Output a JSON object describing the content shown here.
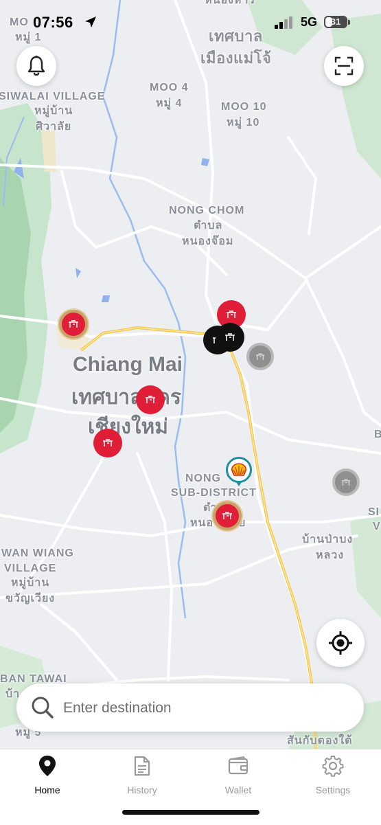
{
  "status_bar": {
    "time": "07:56",
    "network": "5G",
    "battery": "31"
  },
  "map": {
    "labels": {
      "mo": "MO",
      "mu1": "หมู่ 1",
      "mae_jo_1": "เทศบาล",
      "mae_jo_2": "เมืองแม่โจ้",
      "top_partial": "หนองหาร",
      "siwalai_en": "SIWALAI VILLAGE",
      "siwalai_th1": "หมู่บ้าน",
      "siwalai_th2": "ศิวาลัย",
      "moo4_en": "MOO 4",
      "moo4_th": "หมู่ 4",
      "moo10_en": "MOO 10",
      "moo10_th": "หมู่ 10",
      "nongchom_en": "NONG CHOM",
      "nongchom_th1": "ตำบล",
      "nongchom_th2": "หนองจ๊อม",
      "cm_en": "Chiang Mai",
      "cm_th1": "เทศบาลนคร",
      "cm_th2": "เชียงใหม่",
      "nongpa_en1": "NONG",
      "nongpa_en2": "SUB-DISTRICT",
      "nongpa_th1": "ตำ",
      "nongpa_th2": "หนอ",
      "nongpa_th2b": "ย",
      "wanwiang_en1": "WAN WIANG",
      "wanwiang_en2": "VILLAGE",
      "wanwiang_th1": "หมู่บ้าน",
      "wanwiang_th2": "ขวัญเวียง",
      "banpabong_1": "บ้านป่าบง",
      "banpabong_2": "หลวง",
      "bantawai": "BAN TAWAI",
      "ban_left": "บ้า",
      "mu5": "หมู่ 5",
      "santonpaong": "สันกับตองใต้",
      "si": "SI",
      "v": "V",
      "b": "B"
    },
    "colors": {
      "marker_red": "#e01e37",
      "shell_teal": "#1d8f9e",
      "highway": "#f4c84a"
    }
  },
  "buttons": {
    "notification": "bell-icon",
    "scan": "scan-icon",
    "locate": "locate-icon"
  },
  "search": {
    "placeholder": "Enter destination",
    "value": ""
  },
  "tabs": [
    {
      "label": "Home",
      "icon": "map-pin-icon",
      "active": true
    },
    {
      "label": "History",
      "icon": "document-icon",
      "active": false
    },
    {
      "label": "Wallet",
      "icon": "wallet-icon",
      "active": false
    },
    {
      "label": "Settings",
      "icon": "gear-icon",
      "active": false
    }
  ]
}
